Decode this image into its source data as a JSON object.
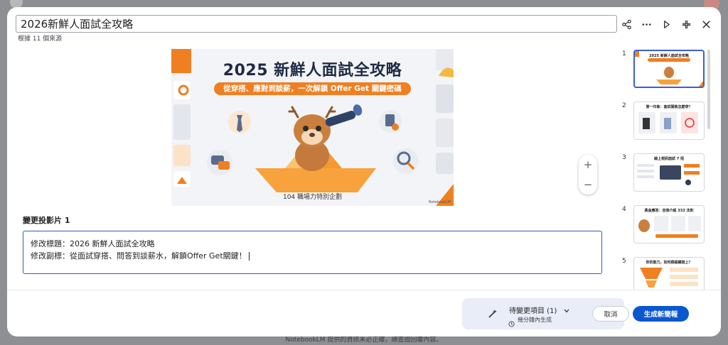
{
  "header": {
    "title_value": "2026新鮮人面試全攻略",
    "source_count": "根據 11 個來源"
  },
  "icons": {
    "share": "share-icon",
    "more": "more-horizontal-icon",
    "present": "play-icon",
    "collapse": "collapse-icon",
    "close": "close-icon"
  },
  "slide": {
    "title": "2025 新鮮人面試全攻略",
    "subtitle": "從穿搭、應對到談薪，一次解鎖 Offer Get 關鍵密碼",
    "footer": "104 職場力特別企劃",
    "watermark": "NotebookLM"
  },
  "zoom": {
    "plus": "+",
    "minus": "−"
  },
  "editor": {
    "label": "變更投影片 1",
    "line1": "修改標題：2026 新鮮人面試全攻略",
    "line2": "修改副標：從面試穿搭、問答到談薪水，解鎖Offer Get關鍵！"
  },
  "thumbnails": [
    {
      "num": "1",
      "title": "2025 新鮮人面試全攻略",
      "selected": true
    },
    {
      "num": "2",
      "title": "第一印象：面試服裝怎麼穿？",
      "selected": false
    },
    {
      "num": "3",
      "title": "線上視訊面試 7 招",
      "selected": false
    },
    {
      "num": "4",
      "title": "黃金應答：自我介紹 333 法則",
      "selected": false
    },
    {
      "num": "5",
      "title": "你的能力，如何跟組織接上？",
      "selected": false
    }
  ],
  "footer_bar": {
    "pending_label": "待變更項目 (1)",
    "pending_sub": "幾分鐘內生成",
    "cancel_label": "取消",
    "generate_label": "生成新簡報"
  },
  "page_footer_note": "NotebookLM 提供的資訊未必正確，請查證回覆內容。",
  "colors": {
    "accent_blue": "#0b57d0",
    "slide_orange": "#f07f22",
    "selection_border": "#3b5fd6"
  }
}
